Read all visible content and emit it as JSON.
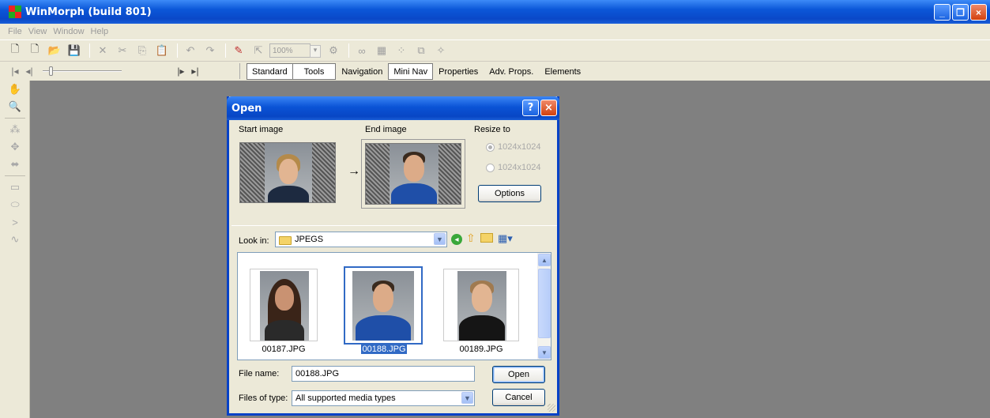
{
  "app": {
    "title": "WinMorph (build 801)"
  },
  "menu": [
    "File",
    "View",
    "Window",
    "Help"
  ],
  "toolbar": {
    "zoom": "100%"
  },
  "tabs": [
    "Standard",
    "Tools",
    "Navigation",
    "Mini Nav",
    "Properties",
    "Adv. Props.",
    "Elements"
  ],
  "dialog": {
    "title": "Open",
    "help_glyph": "?",
    "close_glyph": "×",
    "start_image_label": "Start image",
    "end_image_label": "End image",
    "arrow": "→",
    "resize_label": "Resize to",
    "resize_options": [
      "1024x1024",
      "1024x1024"
    ],
    "options_button": "Options",
    "look_in_label": "Look in:",
    "look_in_value": "JPEGS",
    "files": [
      "00187.JPG",
      "00188.JPG",
      "00189.JPG"
    ],
    "selected_file": "00188.JPG",
    "file_name_label": "File name:",
    "file_name_value": "00188.JPG",
    "files_of_type_label": "Files of type:",
    "files_of_type_value": "All supported media types",
    "open_button": "Open",
    "cancel_button": "Cancel"
  },
  "colors": {
    "title_blue": "#0a53d6",
    "selection": "#316ac5",
    "workspace": "#808080",
    "chrome": "#ece9d8"
  }
}
